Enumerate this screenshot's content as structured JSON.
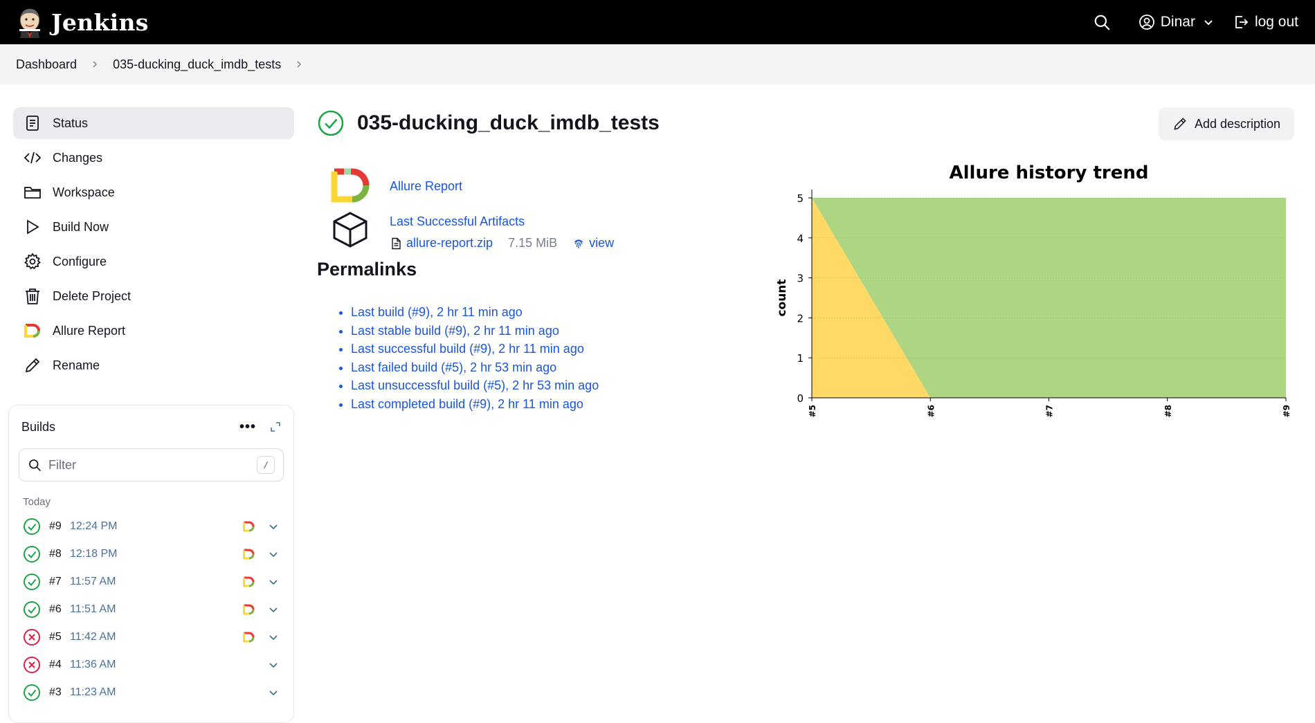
{
  "header": {
    "app_name": "Jenkins",
    "user_name": "Dinar",
    "logout_label": "log out"
  },
  "breadcrumb": {
    "items": [
      "Dashboard",
      "035-ducking_duck_imdb_tests"
    ]
  },
  "sidebar": {
    "tasks": [
      {
        "label": "Status",
        "icon": "status-icon",
        "active": true
      },
      {
        "label": "Changes",
        "icon": "code-icon"
      },
      {
        "label": "Workspace",
        "icon": "folder-icon"
      },
      {
        "label": "Build Now",
        "icon": "play-icon"
      },
      {
        "label": "Configure",
        "icon": "gear-icon"
      },
      {
        "label": "Delete Project",
        "icon": "trash-icon"
      },
      {
        "label": "Allure Report",
        "icon": "allure-icon"
      },
      {
        "label": "Rename",
        "icon": "pencil-icon"
      }
    ]
  },
  "builds": {
    "title": "Builds",
    "more": "•••",
    "filter_placeholder": "Filter",
    "filter_shortcut": "/",
    "group_label": "Today",
    "rows": [
      {
        "number": "#9",
        "time": "12:24 PM",
        "status": "success",
        "allure": true
      },
      {
        "number": "#8",
        "time": "12:18 PM",
        "status": "success",
        "allure": true
      },
      {
        "number": "#7",
        "time": "11:57 AM",
        "status": "success",
        "allure": true
      },
      {
        "number": "#6",
        "time": "11:51 AM",
        "status": "success",
        "allure": true
      },
      {
        "number": "#5",
        "time": "11:42 AM",
        "status": "failed",
        "allure": true
      },
      {
        "number": "#4",
        "time": "11:36 AM",
        "status": "failed",
        "allure": false
      },
      {
        "number": "#3",
        "time": "11:23 AM",
        "status": "success",
        "allure": false
      }
    ]
  },
  "main": {
    "title": "035-ducking_duck_imdb_tests",
    "add_description": "Add description",
    "allure_report_link": "Allure Report",
    "artifacts_link": "Last Successful Artifacts",
    "artifact_file": "allure-report.zip",
    "artifact_size": "7.15 MiB",
    "artifact_view": "view",
    "permalinks_title": "Permalinks",
    "permalinks": [
      "Last build (#9), 2 hr 11 min ago",
      "Last stable build (#9), 2 hr 11 min ago",
      "Last successful build (#9), 2 hr 11 min ago",
      "Last failed build (#5), 2 hr 53 min ago",
      "Last unsuccessful build (#5), 2 hr 53 min ago",
      "Last completed build (#9), 2 hr 11 min ago"
    ]
  },
  "colors": {
    "success": "#1ea446",
    "failed": "#e11d48",
    "link": "#1a56db",
    "passed_area": "#aed581",
    "failed_area": "#ffd966"
  },
  "chart_data": {
    "type": "area",
    "title": "Allure history trend",
    "xlabel": "",
    "ylabel": "count",
    "categories": [
      "#5",
      "#6",
      "#7",
      "#8",
      "#9"
    ],
    "yticks": [
      0,
      1,
      2,
      3,
      4,
      5
    ],
    "ylim": [
      0,
      5
    ],
    "grid": true,
    "series": [
      {
        "values": [
          5,
          0,
          0,
          0,
          0
        ],
        "color": "#ffd966"
      },
      {
        "values": [
          0,
          5,
          5,
          5,
          5
        ],
        "color": "#aed581"
      }
    ]
  }
}
